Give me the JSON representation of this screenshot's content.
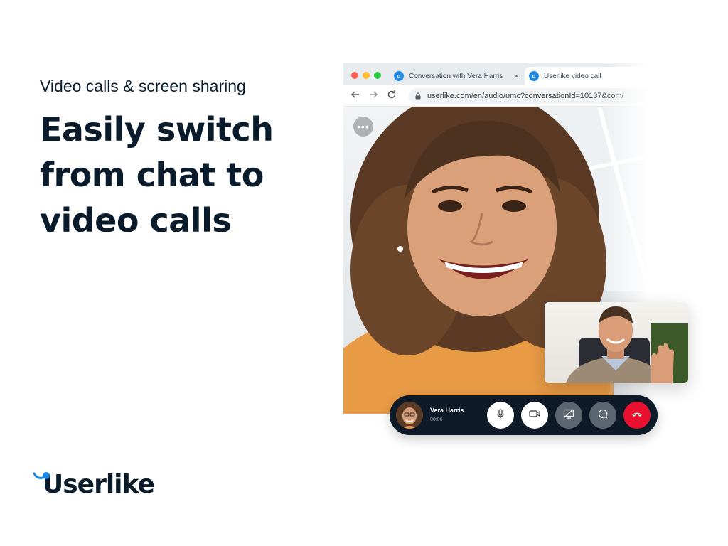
{
  "hero": {
    "kicker": "Video calls & screen sharing",
    "headline_lines": [
      "Easily switch",
      "from chat to",
      "video calls"
    ]
  },
  "brand": {
    "logo_text": "Userlike",
    "accent_color": "#1e88e5",
    "dark_color": "#0a1b2c"
  },
  "browser": {
    "window_dots": [
      "#ff5f57",
      "#febc2e",
      "#28c840"
    ],
    "tabs": [
      {
        "label": "Conversation with Vera Harris",
        "icon": "userlike-icon",
        "close": "×"
      },
      {
        "label": "Userlike video call",
        "icon": "userlike-icon"
      }
    ],
    "url": "userlike.com/en/audio/umc?conversationId=10137&conv",
    "nav_icons": [
      "back-arrow-icon",
      "forward-arrow-icon",
      "reload-icon",
      "lock-icon"
    ]
  },
  "video": {
    "more_button": "•••",
    "self_view_icon": "self-preview-video"
  },
  "call_bar": {
    "caller_name": "Vera Harris",
    "elapsed": "00:06",
    "buttons": [
      {
        "name": "microphone-button",
        "icon": "microphone-icon",
        "color": "#ffffff"
      },
      {
        "name": "camera-button",
        "icon": "camera-icon",
        "color": "#ffffff"
      },
      {
        "name": "screen-share-button",
        "icon": "screen-share-off-icon",
        "color": "#5c6670"
      },
      {
        "name": "chat-button",
        "icon": "chat-bubble-icon",
        "color": "#5c6670"
      },
      {
        "name": "hang-up-button",
        "icon": "phone-hangup-icon",
        "color": "#e8102e"
      }
    ]
  }
}
